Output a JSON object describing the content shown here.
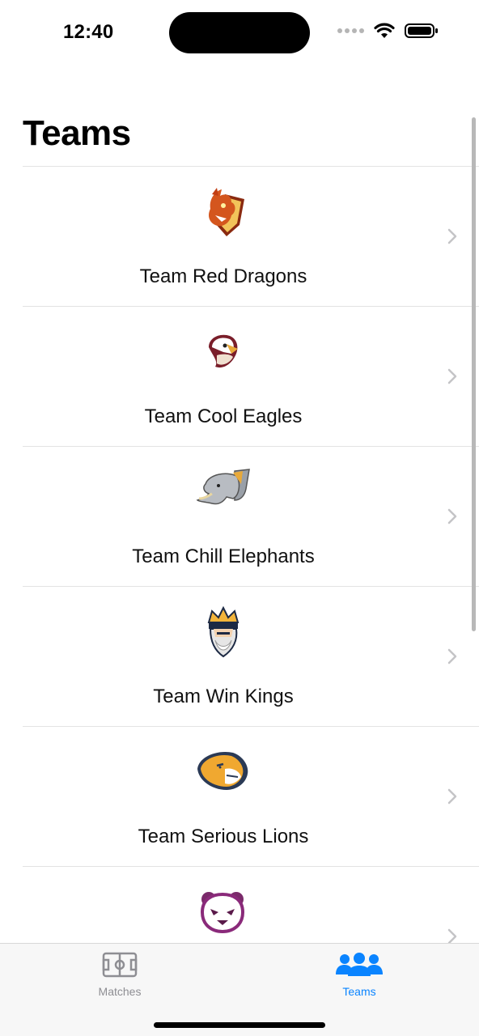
{
  "status_bar": {
    "time": "12:40"
  },
  "page": {
    "title": "Teams"
  },
  "teams": [
    {
      "name": "Team Red Dragons",
      "logo_icon": "dragon-logo-icon"
    },
    {
      "name": "Team Cool Eagles",
      "logo_icon": "eagle-logo-icon"
    },
    {
      "name": "Team Chill Elephants",
      "logo_icon": "elephant-logo-icon"
    },
    {
      "name": "Team Win Kings",
      "logo_icon": "king-logo-icon"
    },
    {
      "name": "Team Serious Lions",
      "logo_icon": "lion-logo-icon"
    },
    {
      "name": "",
      "logo_icon": "panda-logo-icon"
    }
  ],
  "tab_bar": {
    "tabs": [
      {
        "label": "Matches",
        "icon": "pitch-icon",
        "selected": false
      },
      {
        "label": "Teams",
        "icon": "people-icon",
        "selected": true
      }
    ]
  },
  "colors": {
    "accent": "#0a84ff",
    "inactive": "#8e8e93",
    "separator": "#e3e3e3"
  }
}
